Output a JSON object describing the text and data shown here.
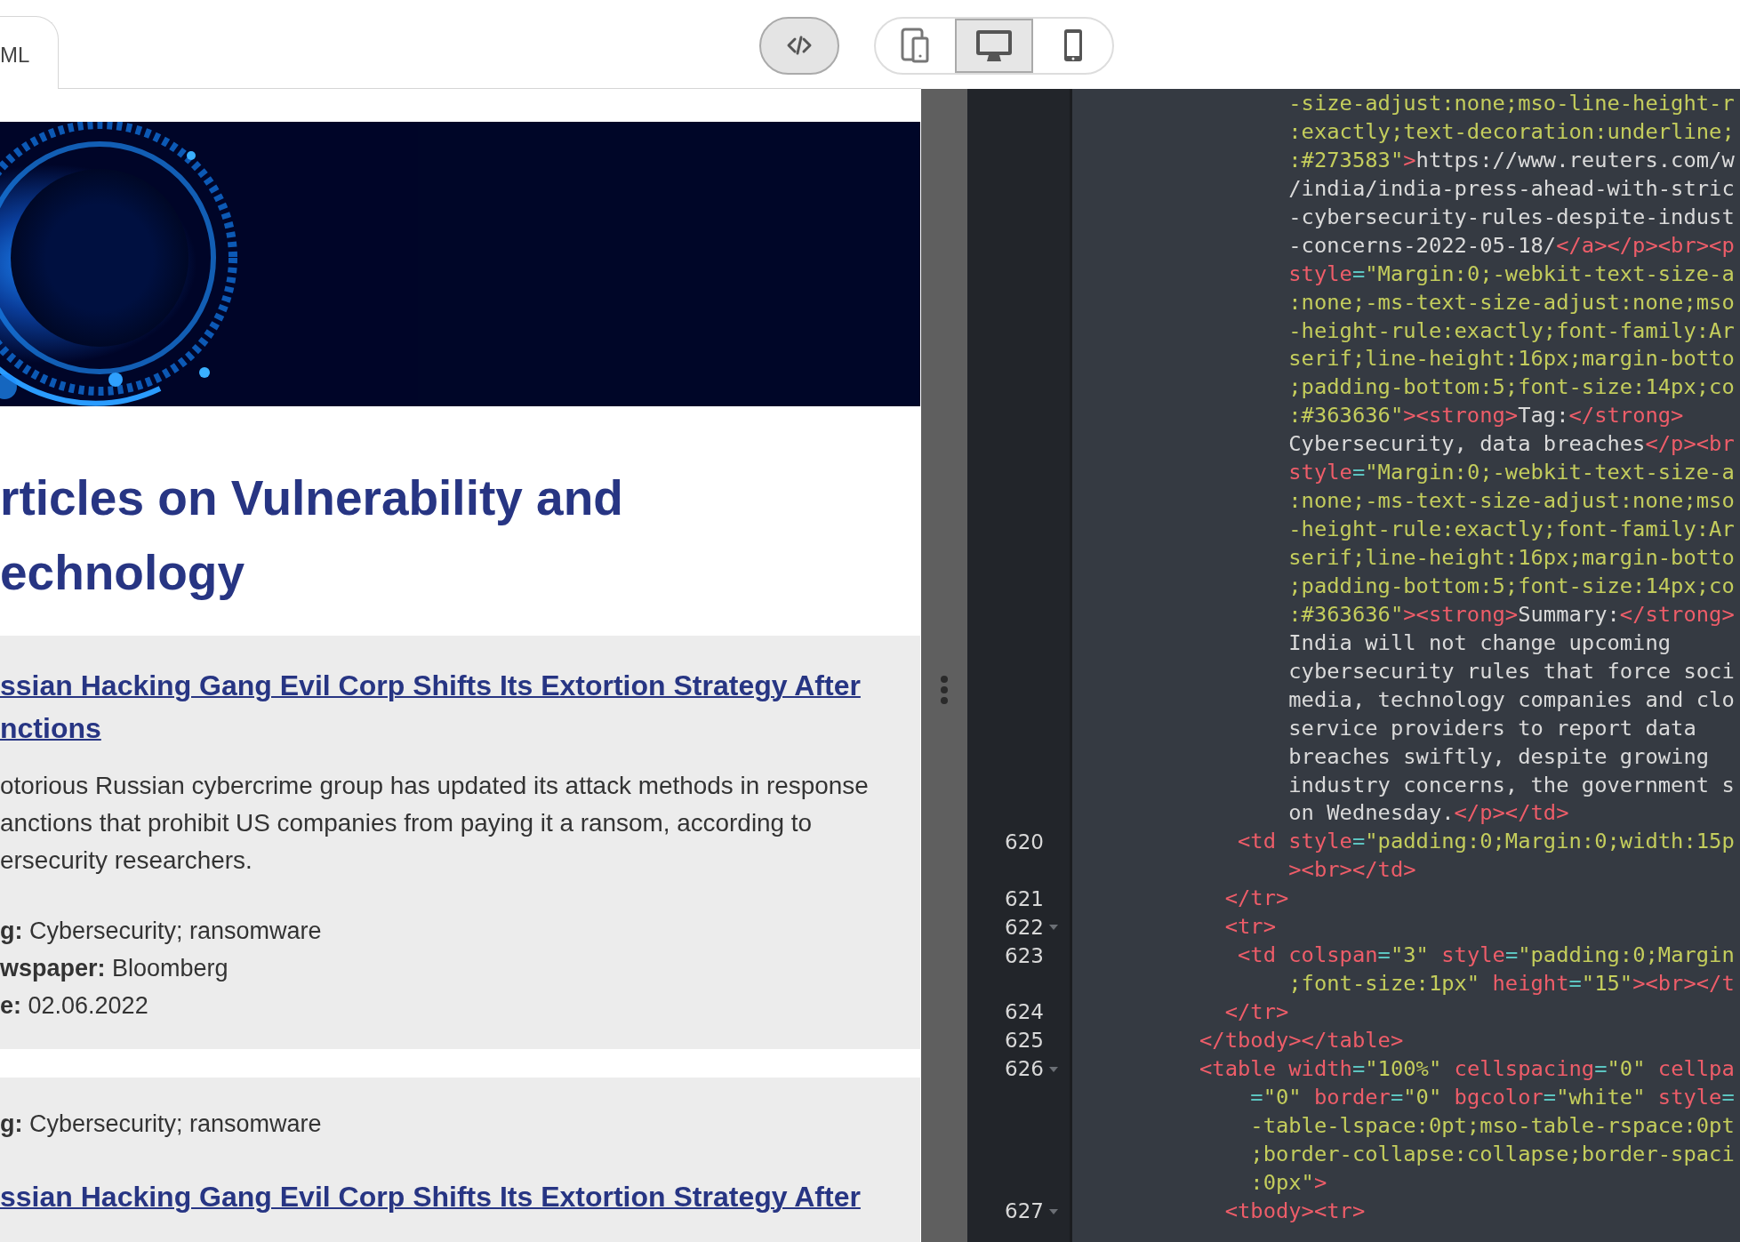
{
  "tabs": [
    {
      "label": "ML",
      "selected": true
    }
  ],
  "code_toggle": {
    "on": true
  },
  "devices": [
    {
      "kind": "responsive",
      "selected": false
    },
    {
      "kind": "desktop",
      "selected": true
    },
    {
      "kind": "phone",
      "selected": false
    }
  ],
  "preview": {
    "banner": {
      "kind": "picture"
    },
    "heading": [
      "rticles on Vulnerability and",
      "echnology"
    ],
    "cards": [
      {
        "blocks": [
          {
            "kind": "title",
            "lines": [
              "ssian Hacking Gang Evil Corp Shifts Its Extortion Strategy After",
              "nctions"
            ]
          },
          {
            "kind": "summary",
            "lines": [
              "otorious Russian cybercrime group has updated its attack methods in response",
              "anctions that prohibit US companies from paying it a ransom, according to",
              "ersecurity researchers."
            ]
          },
          {
            "kind": "meta",
            "lines": [
              "**g:** Cybersecurity; ransomware",
              "**wspaper:** Bloomberg",
              "**e:** 02.06.2022"
            ]
          }
        ]
      },
      {
        "blocks": [
          {
            "kind": "meta",
            "lines": [
              "**g:** Cybersecurity; ransomware"
            ]
          },
          {
            "kind": "title",
            "lines": [
              "ssian Hacking Gang Evil Corp Shifts Its Extortion Strategy After"
            ]
          }
        ]
      }
    ]
  },
  "editor": {
    "lines": [
      {
        "segs": [
          {
            "kind": "str",
            "text": "       -size-adjust:none;mso-line-height-r"
          }
        ]
      },
      {
        "segs": [
          {
            "kind": "str",
            "text": "       :exactly;text-decoration:underline;"
          }
        ]
      },
      {
        "segs": [
          {
            "kind": "str",
            "text": "       :#273583\""
          },
          {
            "kind": "tag",
            "text": ">"
          },
          {
            "kind": "txt",
            "text": "https://www.reuters.com/w"
          }
        ]
      },
      {
        "segs": [
          {
            "kind": "txt",
            "text": "       /india/india-press-ahead-with-stric"
          }
        ]
      },
      {
        "segs": [
          {
            "kind": "txt",
            "text": "       -cybersecurity-rules-despite-indust"
          }
        ]
      },
      {
        "segs": [
          {
            "kind": "txt",
            "text": "       -concerns-2022-05-18/"
          },
          {
            "kind": "tag",
            "text": "</a></p><br><p"
          }
        ]
      },
      {
        "segs": [
          {
            "kind": "attr",
            "text": "       style"
          },
          {
            "kind": "eq",
            "text": "="
          },
          {
            "kind": "str",
            "text": "\"Margin:0;-webkit-text-size-a"
          }
        ]
      },
      {
        "segs": [
          {
            "kind": "str",
            "text": "       :none;-ms-text-size-adjust:none;mso"
          }
        ]
      },
      {
        "segs": [
          {
            "kind": "str",
            "text": "       -height-rule:exactly;font-family:Ar"
          }
        ]
      },
      {
        "segs": [
          {
            "kind": "str",
            "text": "       serif;line-height:16px;margin-botto"
          }
        ]
      },
      {
        "segs": [
          {
            "kind": "str",
            "text": "       ;padding-bottom:5;font-size:14px;co"
          }
        ]
      },
      {
        "segs": [
          {
            "kind": "str",
            "text": "       :#363636\""
          },
          {
            "kind": "tag",
            "text": "><strong>"
          },
          {
            "kind": "txt",
            "text": "Tag:"
          },
          {
            "kind": "tag",
            "text": "</strong>"
          }
        ]
      },
      {
        "segs": [
          {
            "kind": "txt",
            "text": "       Cybersecurity, data breaches"
          },
          {
            "kind": "tag",
            "text": "</p><br"
          }
        ]
      },
      {
        "segs": [
          {
            "kind": "attr",
            "text": "       style"
          },
          {
            "kind": "eq",
            "text": "="
          },
          {
            "kind": "str",
            "text": "\"Margin:0;-webkit-text-size-a"
          }
        ]
      },
      {
        "segs": [
          {
            "kind": "str",
            "text": "       :none;-ms-text-size-adjust:none;mso"
          }
        ]
      },
      {
        "segs": [
          {
            "kind": "str",
            "text": "       -height-rule:exactly;font-family:Ar"
          }
        ]
      },
      {
        "segs": [
          {
            "kind": "str",
            "text": "       serif;line-height:16px;margin-botto"
          }
        ]
      },
      {
        "segs": [
          {
            "kind": "str",
            "text": "       ;padding-bottom:5;font-size:14px;co"
          }
        ]
      },
      {
        "segs": [
          {
            "kind": "str",
            "text": "       :#363636\""
          },
          {
            "kind": "tag",
            "text": "><strong>"
          },
          {
            "kind": "txt",
            "text": "Summary:"
          },
          {
            "kind": "tag",
            "text": "</strong>"
          }
        ]
      },
      {
        "segs": [
          {
            "kind": "txt",
            "text": "       India will not change upcoming"
          }
        ]
      },
      {
        "segs": [
          {
            "kind": "txt",
            "text": "       cybersecurity rules that force soci"
          }
        ]
      },
      {
        "segs": [
          {
            "kind": "txt",
            "text": "       media, technology companies and clo"
          }
        ]
      },
      {
        "segs": [
          {
            "kind": "txt",
            "text": "       service providers to report data"
          }
        ]
      },
      {
        "segs": [
          {
            "kind": "txt",
            "text": "       breaches swiftly, despite growing"
          }
        ]
      },
      {
        "segs": [
          {
            "kind": "txt",
            "text": "       industry concerns, the government s"
          }
        ]
      },
      {
        "segs": [
          {
            "kind": "txt",
            "text": "       on Wednesday."
          },
          {
            "kind": "tag",
            "text": "</p></td>"
          }
        ]
      },
      {
        "n": "620",
        "fold": false,
        "segs": [
          {
            "kind": "tag",
            "text": "   <td"
          },
          {
            "kind": "attr",
            "text": " style"
          },
          {
            "kind": "eq",
            "text": "="
          },
          {
            "kind": "str",
            "text": "\"padding:0;Margin:0;width:15p"
          }
        ]
      },
      {
        "segs": [
          {
            "kind": "tag",
            "text": "       ><br></td>"
          }
        ]
      },
      {
        "n": "621",
        "fold": false,
        "segs": [
          {
            "kind": "tag",
            "text": "  </tr>"
          }
        ]
      },
      {
        "n": "622",
        "fold": true,
        "segs": [
          {
            "kind": "tag",
            "text": "  <tr>"
          }
        ]
      },
      {
        "n": "623",
        "fold": false,
        "segs": [
          {
            "kind": "tag",
            "text": "   <td"
          },
          {
            "kind": "attr",
            "text": " colspan"
          },
          {
            "kind": "eq",
            "text": "="
          },
          {
            "kind": "str",
            "text": "\"3\""
          },
          {
            "kind": "attr",
            "text": " style"
          },
          {
            "kind": "eq",
            "text": "="
          },
          {
            "kind": "str",
            "text": "\"padding:0;Margin"
          }
        ]
      },
      {
        "segs": [
          {
            "kind": "str",
            "text": "       ;font-size:1px\""
          },
          {
            "kind": "attr",
            "text": " height"
          },
          {
            "kind": "eq",
            "text": "="
          },
          {
            "kind": "str",
            "text": "\"15\""
          },
          {
            "kind": "tag",
            "text": "><br></t"
          }
        ]
      },
      {
        "n": "624",
        "fold": false,
        "segs": [
          {
            "kind": "tag",
            "text": "  </tr>"
          }
        ]
      },
      {
        "n": "625",
        "fold": false,
        "segs": [
          {
            "kind": "tag",
            "text": "</tbody></table>"
          }
        ]
      },
      {
        "n": "626",
        "fold": true,
        "segs": [
          {
            "kind": "tag",
            "text": "<table"
          },
          {
            "kind": "attr",
            "text": " width"
          },
          {
            "kind": "eq",
            "text": "="
          },
          {
            "kind": "str",
            "text": "\"100%\""
          },
          {
            "kind": "attr",
            "text": " cellspacing"
          },
          {
            "kind": "eq",
            "text": "="
          },
          {
            "kind": "str",
            "text": "\"0\""
          },
          {
            "kind": "attr",
            "text": " cellpa"
          }
        ]
      },
      {
        "segs": [
          {
            "kind": "eq",
            "text": "    ="
          },
          {
            "kind": "str",
            "text": "\"0\""
          },
          {
            "kind": "attr",
            "text": " border"
          },
          {
            "kind": "eq",
            "text": "="
          },
          {
            "kind": "str",
            "text": "\"0\""
          },
          {
            "kind": "attr",
            "text": " bgcolor"
          },
          {
            "kind": "eq",
            "text": "="
          },
          {
            "kind": "str",
            "text": "\"white\""
          },
          {
            "kind": "attr",
            "text": " style"
          },
          {
            "kind": "eq",
            "text": "="
          }
        ]
      },
      {
        "segs": [
          {
            "kind": "str",
            "text": "    -table-lspace:0pt;mso-table-rspace:0pt"
          }
        ]
      },
      {
        "segs": [
          {
            "kind": "str",
            "text": "    ;border-collapse:collapse;border-spaci"
          }
        ]
      },
      {
        "segs": [
          {
            "kind": "str",
            "text": "    :0px\""
          },
          {
            "kind": "tag",
            "text": ">"
          }
        ]
      },
      {
        "n": "627",
        "fold": true,
        "segs": [
          {
            "kind": "tag",
            "text": "  <tbody><tr>"
          }
        ]
      }
    ]
  }
}
